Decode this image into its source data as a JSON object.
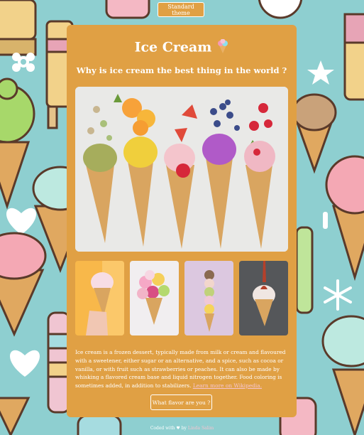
{
  "theme_button": {
    "label": "Standard theme"
  },
  "card": {
    "title": "Ice Cream",
    "subtitle": "Why is ice cream the best thing in the world ?",
    "description": "Ice cream is a frozen dessert, typically made from milk or cream and flavoured with a sweetener, either sugar or an alternative, and a spice, such as cocoa or vanilla, or with fruit such as strawberries or peaches. It can also be made by whisking a flavored cream base and liquid nitrogen together. Food coloring is sometimes added, in addition to stabilizers.",
    "wiki_link": "Learn more on Wikipedia.",
    "flavor_button": "What flavor are you ?"
  },
  "footer": {
    "prefix": "Coded with ",
    "middle": " by ",
    "author": "Linda Salim"
  },
  "icons": {
    "title_emoji": "ice-cream-icon",
    "footer_emoji": "heart-icon"
  },
  "colors": {
    "background": "#8ecfd0",
    "card": "#e0a044",
    "accent_pink": "#f6c4cf"
  }
}
